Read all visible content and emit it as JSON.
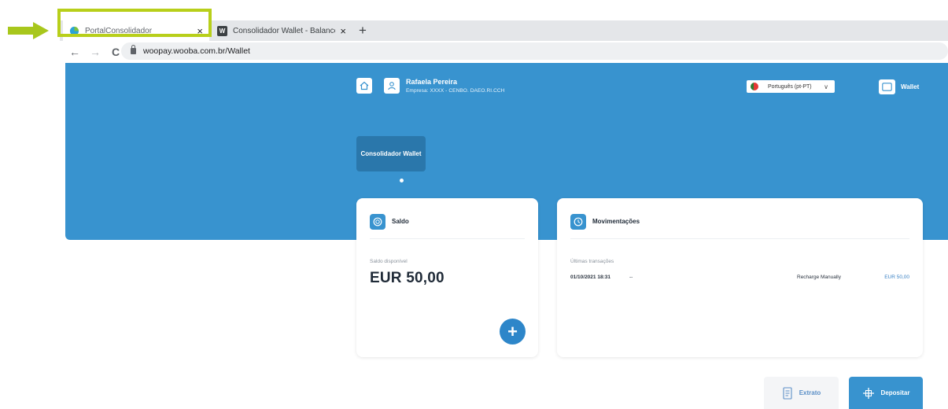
{
  "browser": {
    "tabs": [
      {
        "title": "PortalConsolidador",
        "active": true
      },
      {
        "title": "Consolidador Wallet - Balance",
        "active": false
      }
    ],
    "close_glyph": "×",
    "new_tab_glyph": "+",
    "url": "woopay.wooba.com.br/Wallet",
    "nav": {
      "back": "←",
      "forward": "→",
      "reload": "C"
    }
  },
  "header": {
    "user_name": "Rafaela Pereira",
    "company": "Empresa: XXXX - CENBO. DAEO.RI.CCH",
    "language": "Português (pt-PT)",
    "language_caret": "∨",
    "wallet_label": "Wallet"
  },
  "section": {
    "button_label": "Consolidador Wallet"
  },
  "saldo": {
    "title": "Saldo",
    "label": "Saldo disponível",
    "value": "EUR 50,00",
    "add_glyph": "+"
  },
  "movimentacoes": {
    "title": "Movimentações",
    "label": "Últimas transações",
    "transactions": [
      {
        "date": "01/10/2021 18:31",
        "dash": "--",
        "description": "Recharge Manually",
        "amount": "EUR 50,00"
      }
    ]
  },
  "actions": {
    "extrato": "Extrato",
    "depositar": "Depositar"
  },
  "colors": {
    "primary": "#3893cf",
    "primary_dark": "#2a77ab",
    "highlight": "#b8cf1a",
    "arrow": "#a8c71c"
  },
  "icons": {
    "home": "home-icon",
    "user": "user-icon",
    "wallet": "wallet-icon",
    "saldo": "coin-icon",
    "movimentacoes": "clock-icon",
    "extrato": "receipt-icon",
    "depositar": "deposit-icon"
  }
}
